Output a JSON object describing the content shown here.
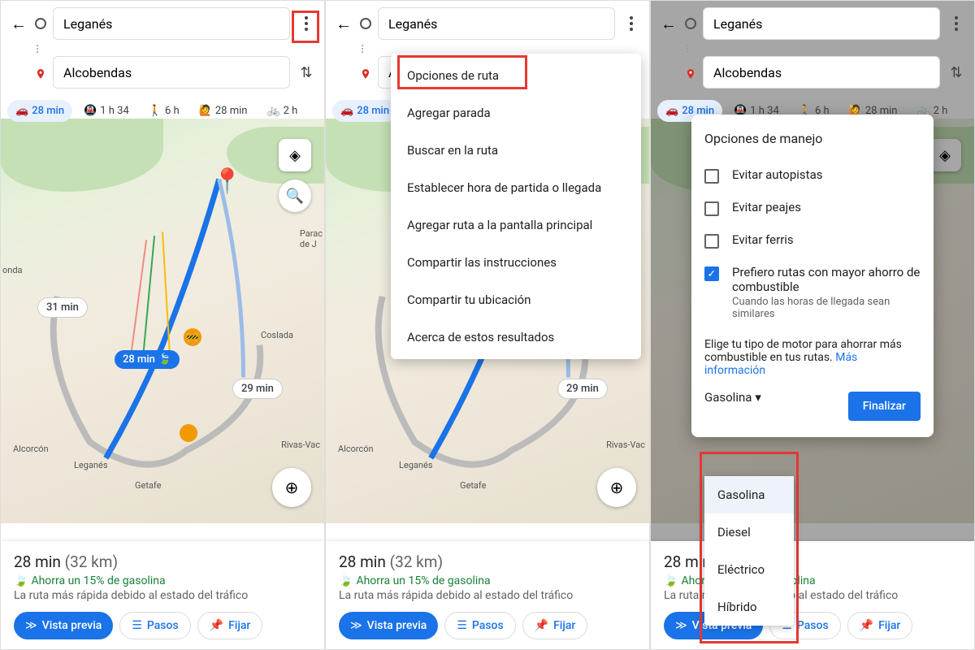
{
  "search": {
    "origin": "Leganés",
    "destination": "Alcobendas"
  },
  "modes": {
    "car": "28 min",
    "transit": "1 h 34",
    "walk": "6 h",
    "rideshare": "28 min",
    "bike": "2 h"
  },
  "map": {
    "main_time": "28 min",
    "alt1": "31 min",
    "alt2": "29 min",
    "cities": {
      "alcorcón": "Alcorcón",
      "leganés": "Leganés",
      "getafe": "Getafe",
      "coslada": "Coslada",
      "rivas": "Rivas-Vac",
      "paracuellos": "Parac\nde J",
      "onda": "onda"
    }
  },
  "sheet": {
    "time": "28 min",
    "dist": "(32 km)",
    "eco": "Ahorra un 15% de gasolina",
    "desc": "La ruta más rápida debido al estado del tráfico",
    "preview": "Vista previa",
    "steps": "Pasos",
    "pin": "Fijar"
  },
  "menu": {
    "route_options": "Opciones de ruta",
    "add_stop": "Agregar parada",
    "search_route": "Buscar en la ruta",
    "set_time": "Establecer hora de partida o llegada",
    "add_home": "Agregar ruta a la pantalla principal",
    "share_dirs": "Compartir las instrucciones",
    "share_loc": "Compartir tu ubicación",
    "about": "Acerca de estos resultados"
  },
  "options": {
    "title": "Opciones de manejo",
    "avoid_hwy": "Evitar autopistas",
    "avoid_tolls": "Evitar peajes",
    "avoid_ferries": "Evitar ferris",
    "fuel_title": "Prefiero rutas con mayor ahorro de combustible",
    "fuel_sub": "Cuando las horas de llegada sean similares",
    "engine_text": "Elige tu tipo de motor para ahorrar más combustible en tus rutas. ",
    "more_info": "Más información",
    "engine_selected": "Gasolina",
    "engines": [
      "Gasolina",
      "Diesel",
      "Eléctrico",
      "Híbrido"
    ],
    "finalize": "Finalizar"
  }
}
